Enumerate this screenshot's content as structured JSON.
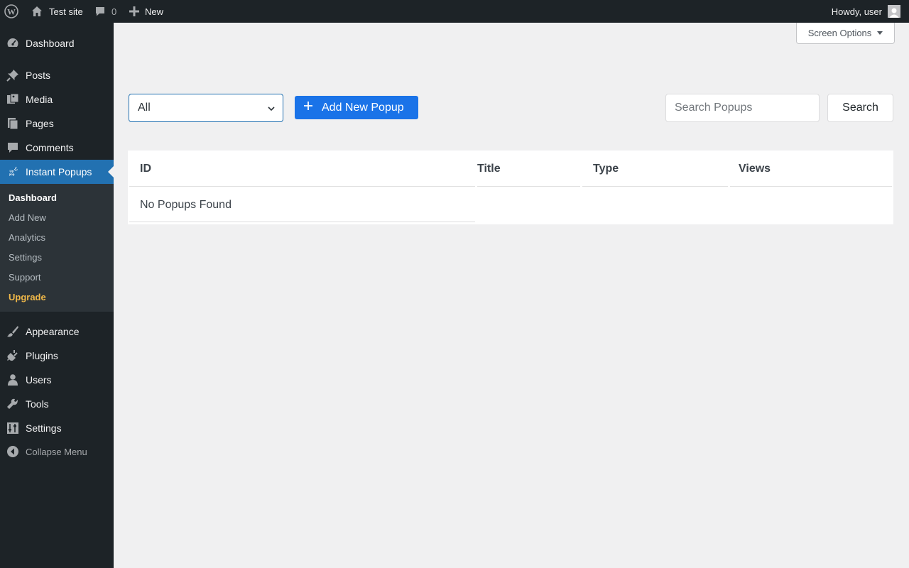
{
  "adminbar": {
    "site_name": "Test site",
    "comments_count": "0",
    "new_label": "New",
    "howdy": "Howdy, user"
  },
  "sidebar": {
    "items": [
      {
        "label": "Dashboard",
        "icon": "dashboard-icon"
      },
      {
        "label": "Posts",
        "icon": "pin-icon"
      },
      {
        "label": "Media",
        "icon": "media-icon"
      },
      {
        "label": "Pages",
        "icon": "pages-icon"
      },
      {
        "label": "Comments",
        "icon": "comment-icon"
      },
      {
        "label": "Instant Popups",
        "icon": "uppop-logo-icon",
        "current": true
      },
      {
        "label": "Appearance",
        "icon": "brush-icon"
      },
      {
        "label": "Plugins",
        "icon": "plugin-icon"
      },
      {
        "label": "Users",
        "icon": "user-icon"
      },
      {
        "label": "Tools",
        "icon": "wrench-icon"
      },
      {
        "label": "Settings",
        "icon": "settings-icon"
      }
    ],
    "submenu": [
      "Dashboard",
      "Add New",
      "Analytics",
      "Settings",
      "Support",
      "Upgrade"
    ],
    "collapse_label": "Collapse Menu",
    "accent_color": "#2271b1",
    "upgrade_color": "#f0b849"
  },
  "screen_options": "Screen Options",
  "filter": {
    "selected": "All"
  },
  "add_new_button": "Add New Popup",
  "search": {
    "placeholder": "Search Popups",
    "button": "Search"
  },
  "table": {
    "columns": [
      "ID",
      "Title",
      "Type",
      "Views"
    ],
    "empty_message": "No Popups Found"
  },
  "button_color": "#1a73e8"
}
